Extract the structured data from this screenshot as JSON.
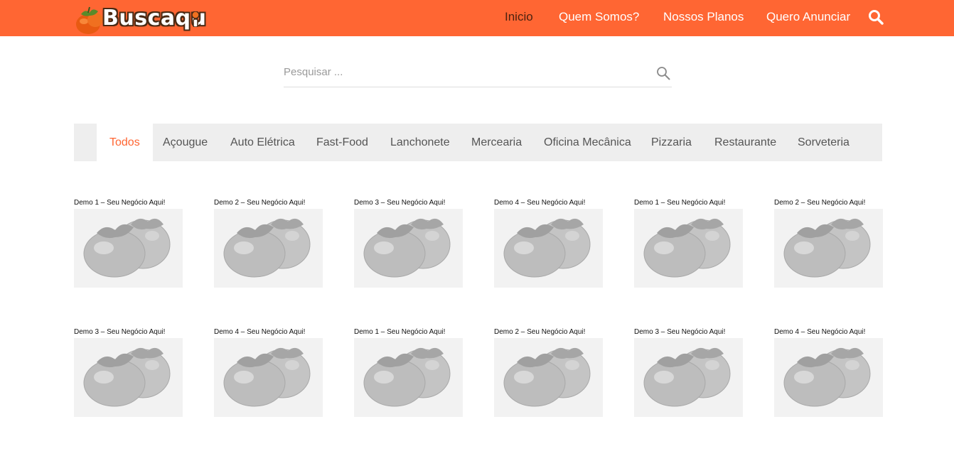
{
  "brand": {
    "logo_text": "Buscaqu",
    "logo_icon": "persimmon-logo-icon"
  },
  "nav": {
    "items": [
      {
        "label": "Inicio",
        "active": true
      },
      {
        "label": "Quem Somos?",
        "active": false
      },
      {
        "label": "Nossos Planos",
        "active": false
      },
      {
        "label": "Quero Anunciar",
        "active": false
      }
    ],
    "search_icon": "search-icon"
  },
  "search": {
    "placeholder": "Pesquisar ...",
    "value": "",
    "icon": "search-icon"
  },
  "filters": {
    "items": [
      {
        "label": "Todos",
        "active": true
      },
      {
        "label": "Açougue",
        "active": false
      },
      {
        "label": "Auto Elétrica",
        "active": false
      },
      {
        "label": "Fast-Food",
        "active": false
      },
      {
        "label": "Lanchonete",
        "active": false
      },
      {
        "label": "Mercearia",
        "active": false
      },
      {
        "label": "Oficina Mecânica",
        "active": false
      },
      {
        "label": "Pizzaria",
        "active": false
      },
      {
        "label": "Restaurante",
        "active": false
      },
      {
        "label": "Sorveteria",
        "active": false
      }
    ]
  },
  "listings": [
    {
      "title": "Demo 1 – Seu Negócio Aqui!"
    },
    {
      "title": "Demo 2 – Seu Negócio Aqui!"
    },
    {
      "title": "Demo 3 – Seu Negócio Aqui!"
    },
    {
      "title": "Demo 4 – Seu Negócio Aqui!"
    },
    {
      "title": "Demo 1 – Seu Negócio Aqui!"
    },
    {
      "title": "Demo 2 – Seu Negócio Aqui!"
    },
    {
      "title": "Demo 3 – Seu Negócio Aqui!"
    },
    {
      "title": "Demo 4 – Seu Negócio Aqui!"
    },
    {
      "title": "Demo 1 – Seu Negócio Aqui!"
    },
    {
      "title": "Demo 2 – Seu Negócio Aqui!"
    },
    {
      "title": "Demo 3 – Seu Negócio Aqui!"
    },
    {
      "title": "Demo 4 – Seu Negócio Aqui!"
    }
  ],
  "colors": {
    "brand": "#ff6633",
    "active_nav": "#4a2210",
    "filter_bg": "#eeeeee",
    "placeholder_bg": "#f2f2f2"
  }
}
